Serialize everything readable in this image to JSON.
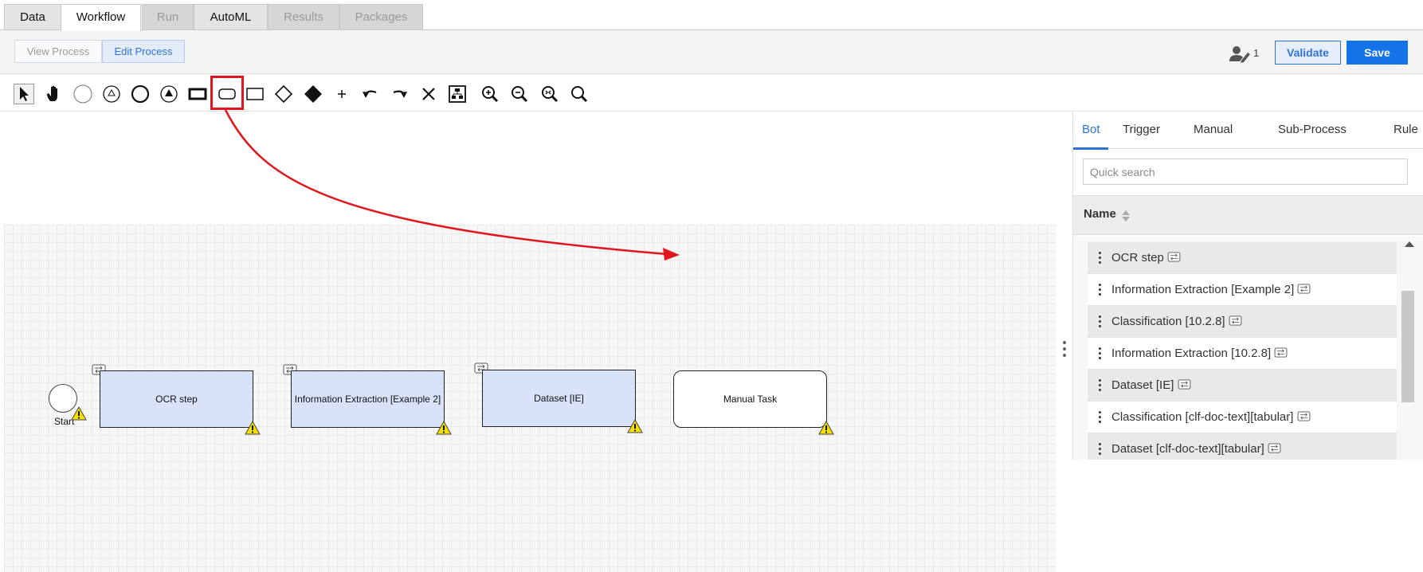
{
  "tabs": [
    {
      "label": "Data",
      "state": "normal"
    },
    {
      "label": "Workflow",
      "state": "active"
    },
    {
      "label": "Run",
      "state": "disabled"
    },
    {
      "label": "AutoML",
      "state": "normal"
    },
    {
      "label": "Results",
      "state": "disabled"
    },
    {
      "label": "Packages",
      "state": "disabled"
    }
  ],
  "process_modes": {
    "view": "View Process",
    "edit": "Edit Process"
  },
  "header": {
    "users_count": "1",
    "validate_label": "Validate",
    "save_label": "Save"
  },
  "toolbar_tools": [
    "pointer-tool-icon",
    "hand-pan-icon",
    "start-event-icon",
    "intermediate-event-icon",
    "end-event-icon",
    "signal-event-icon",
    "task-icon",
    "rounded-task-icon",
    "subprocess-icon",
    "gateway-icon",
    "filled-gateway-icon",
    "add-icon",
    "undo-icon",
    "redo-icon",
    "delete-icon",
    "auto-layout-icon",
    "zoom-in-icon",
    "zoom-out-icon",
    "zoom-fit-icon",
    "zoom-reset-icon"
  ],
  "canvas": {
    "start_label": "Start",
    "nodes": [
      {
        "label": "OCR step",
        "kind": "bot"
      },
      {
        "label": "Information Extraction [Example 2]",
        "kind": "bot"
      },
      {
        "label": "Dataset [IE]",
        "kind": "bot"
      },
      {
        "label": "Manual Task",
        "kind": "manual"
      }
    ]
  },
  "panel": {
    "tabs": [
      "Bot",
      "Trigger",
      "Manual",
      "Sub-Process",
      "Rule"
    ],
    "active_tab": "Bot",
    "search_placeholder": "Quick search",
    "column_header": "Name",
    "items": [
      "OCR step",
      "Information Extraction [Example 2]",
      "Classification [10.2.8]",
      "Information Extraction [10.2.8]",
      "Dataset [IE]",
      "Classification [clf-doc-text][tabular]",
      "Dataset [clf-doc-text][tabular]"
    ]
  },
  "colors": {
    "accent": "#1473e6",
    "annotation_red": "#e0161e",
    "bot_fill": "#d8e3fa",
    "warning_yellow": "#f6e000"
  }
}
